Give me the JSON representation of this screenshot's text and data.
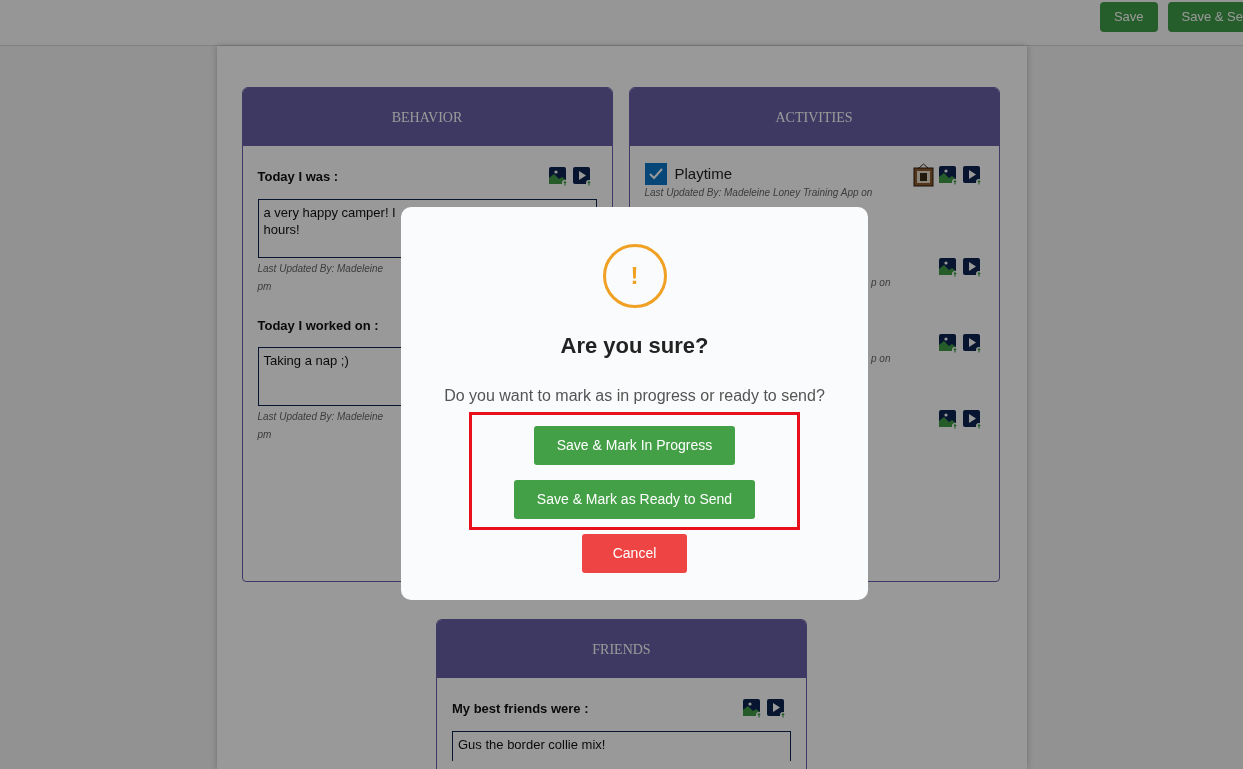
{
  "top_buttons": [
    {
      "label": "Save"
    },
    {
      "label": "Save & Se"
    }
  ],
  "behavior": {
    "title": "BEHAVIOR",
    "fields": [
      {
        "kind": "media",
        "label": "Today I was :",
        "lines": [
          "a very happy camper! I",
          "hours!"
        ],
        "updated": [
          "Last Updated By: Madeleine",
          "pm"
        ]
      },
      {
        "kind": "plain",
        "label": "Today I worked on :",
        "lines": [
          "Taking a nap ;)"
        ],
        "updated": [
          "Last Updated By: Madeleine",
          "pm"
        ]
      }
    ]
  },
  "activities": {
    "title": "ACTIVITIES",
    "items": [
      {
        "kind": "framed",
        "label": "Playtime",
        "checked": true,
        "updated": "Last Updated By: Madeleine Loney Training App on"
      },
      {
        "kind": "plain",
        "updated": "p on"
      },
      {
        "kind": "plain",
        "updated": "p on"
      },
      {
        "kind": "plain"
      }
    ]
  },
  "friends": {
    "title": "FRIENDS",
    "fields": [
      {
        "kind": "media",
        "label": "My best friends were :",
        "lines": [
          "Gus the border collie mix!"
        ]
      }
    ]
  },
  "dialog": {
    "title": "Are you sure?",
    "icon": "!",
    "message": "Do you want to mark as in progress or ready to send?",
    "buttons": [
      {
        "kind": "primary",
        "label": "Save & Mark In Progress",
        "highlighted": true
      },
      {
        "kind": "primary",
        "label": "Save & Mark as Ready to Send",
        "highlighted": true
      },
      {
        "kind": "danger",
        "label": "Cancel",
        "highlighted": false
      }
    ]
  }
}
